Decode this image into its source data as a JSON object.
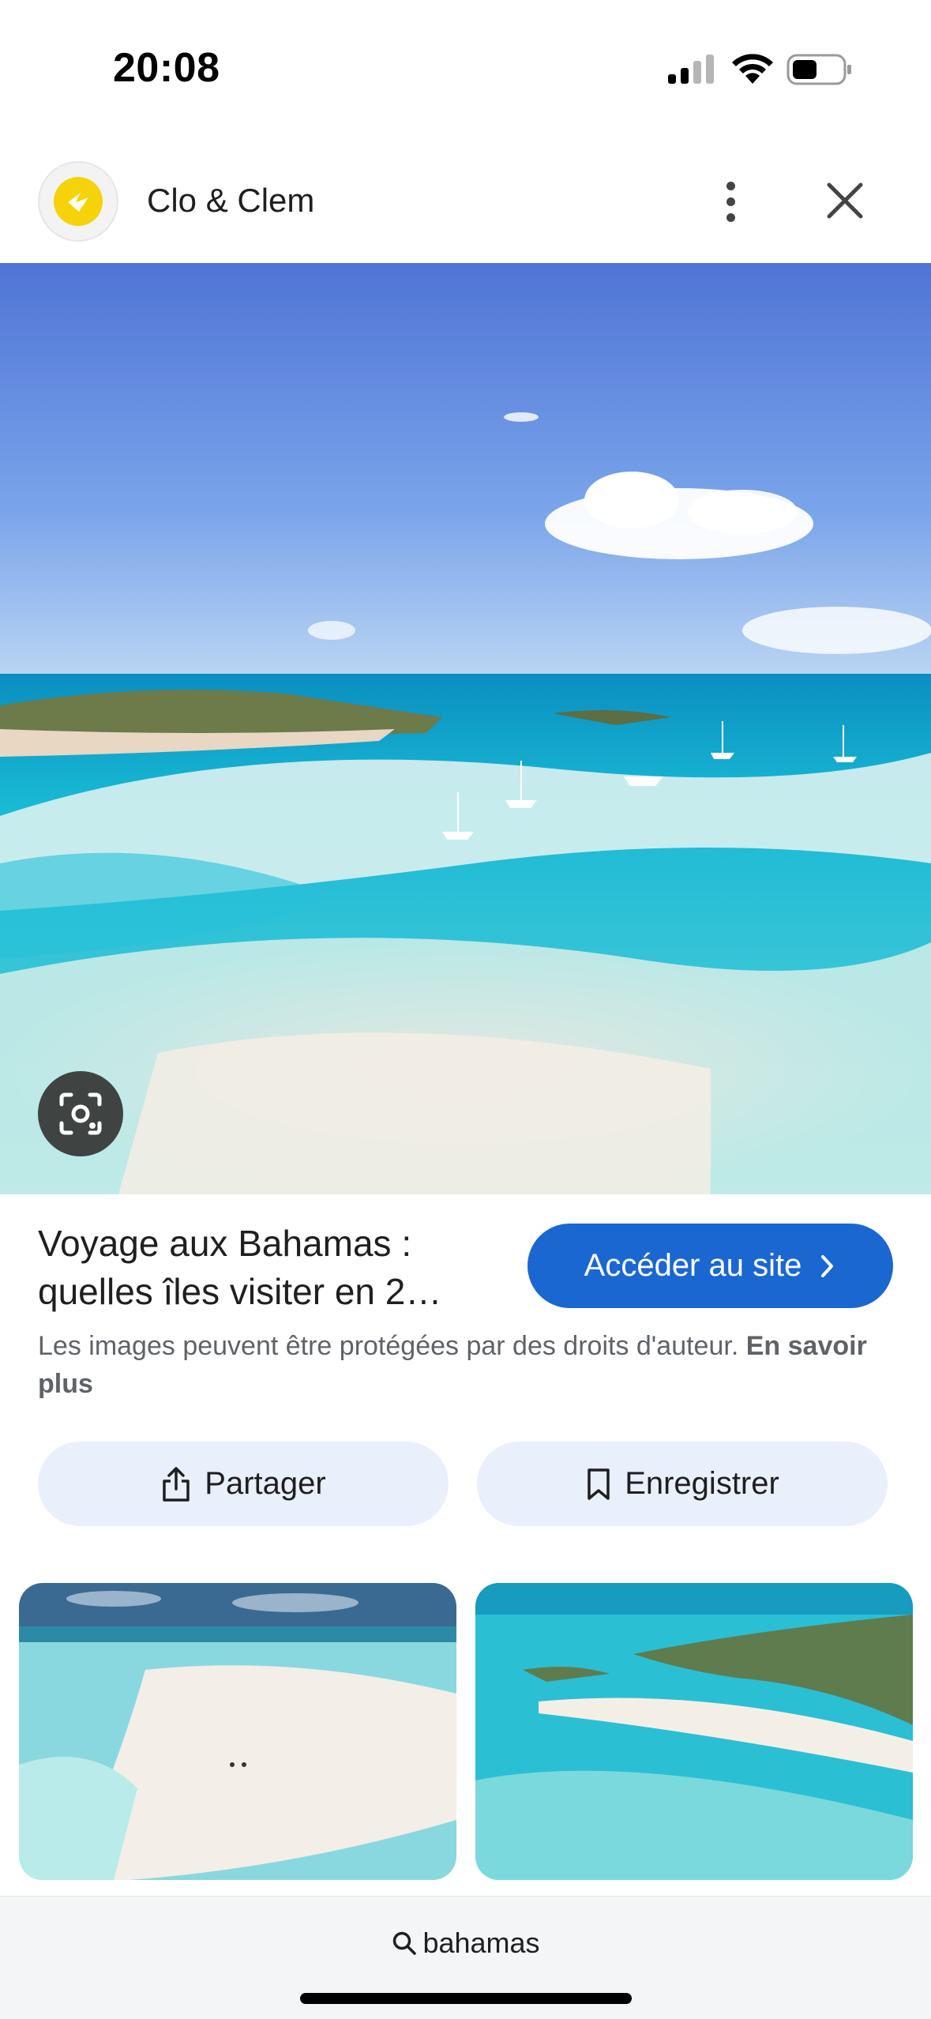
{
  "status_bar": {
    "time": "20:08"
  },
  "header": {
    "site_name": "Clo & Clem"
  },
  "result": {
    "title_line1": "Voyage aux Bahamas :",
    "title_line2": "quelles îles visiter en 2…",
    "visit_label": "Accéder au site",
    "copyright_text": "Les images peuvent être protégées par des droits d'auteur.",
    "learn_more": "En savoir plus"
  },
  "actions": {
    "share_label": "Partager",
    "save_label": "Enregistrer"
  },
  "bottom_bar": {
    "query": "bahamas"
  },
  "colors": {
    "accent": "#1a67d2",
    "action_bg": "#e9effb",
    "logo_yellow": "#f5d20a"
  }
}
